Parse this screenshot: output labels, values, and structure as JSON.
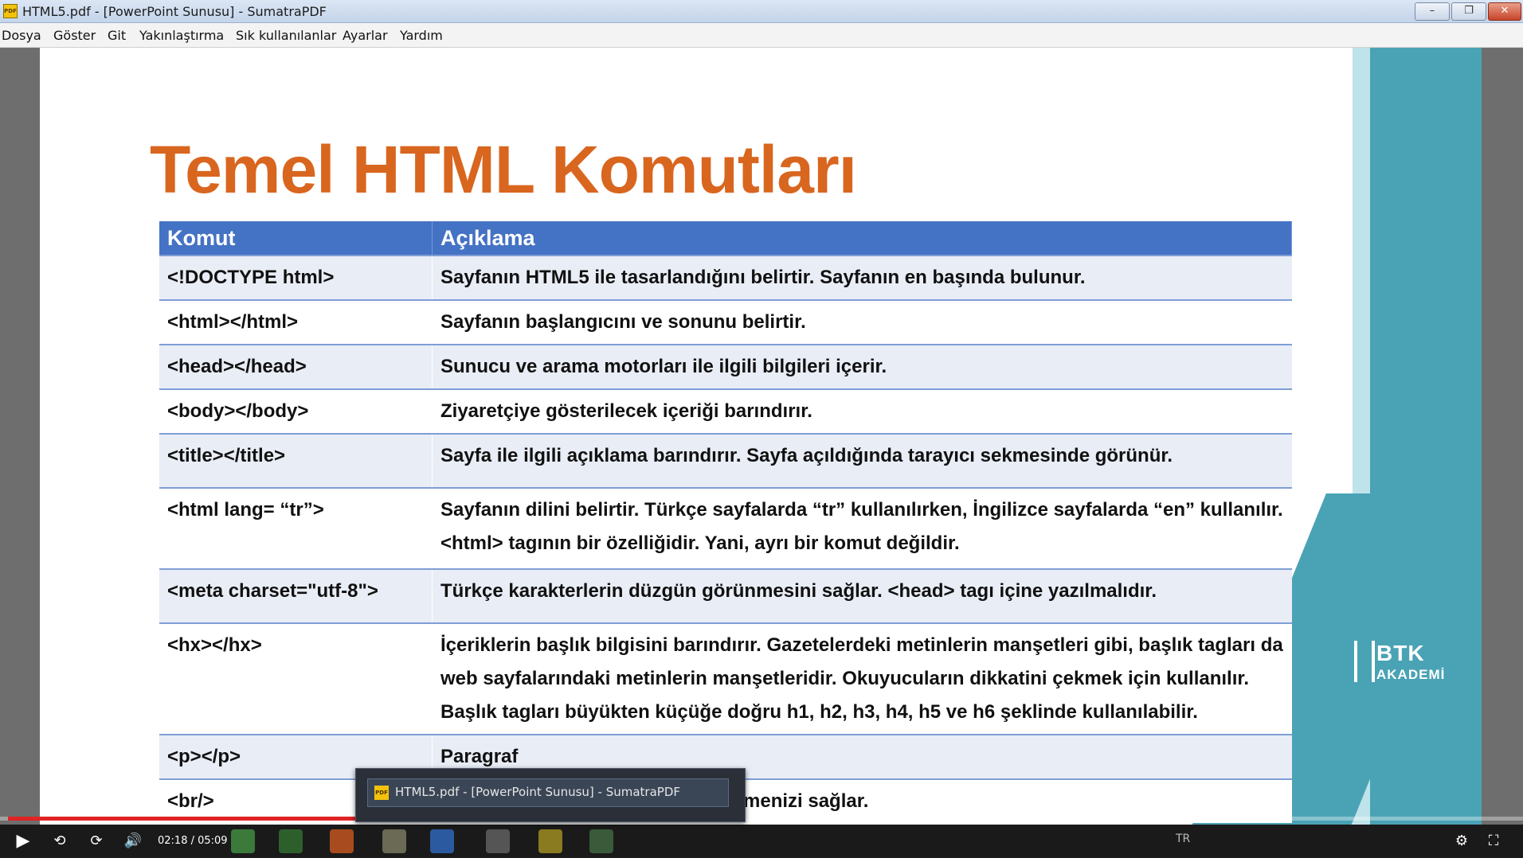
{
  "window": {
    "title": "HTML5.pdf - [PowerPoint Sunusu] - SumatraPDF",
    "icon": "sumatrapdf-icon",
    "controls": {
      "minimize": "–",
      "maximize": "❐",
      "close": "✕"
    }
  },
  "menu": [
    "Dosya",
    "Göster",
    "Git",
    "Yakınlaştırma",
    "Sık kullanılanlar",
    "Ayarlar",
    "Yardım"
  ],
  "slide": {
    "title": "Temel HTML Komutları",
    "logo": {
      "line1": "BTK",
      "line2": "AKADEMİ"
    },
    "table": {
      "headers": [
        "Komut",
        "Açıklama"
      ],
      "rows": [
        [
          "<!DOCTYPE html>",
          "Sayfanın HTML5 ile tasarlandığını belirtir. Sayfanın en başında bulunur."
        ],
        [
          "<html></html>",
          "Sayfanın başlangıcını ve sonunu belirtir."
        ],
        [
          "<head></head>",
          "Sunucu ve arama motorları ile ilgili bilgileri içerir."
        ],
        [
          "<body></body>",
          "Ziyaretçiye gösterilecek içeriği barındırır."
        ],
        [
          "<title></title>",
          "Sayfa ile ilgili açıklama barındırır. Sayfa açıldığında tarayıcı sekmesinde görünür."
        ],
        [
          "<html lang= “tr”>",
          "Sayfanın dilini belirtir. Türkçe sayfalarda “tr” kullanılırken, İngilizce sayfalarda “en” kullanılır. <html> tagının bir özelliğidir. Yani, ayrı bir komut değildir."
        ],
        [
          "<meta charset=\"utf-8\">",
          "Türkçe karakterlerin düzgün görünmesini sağlar. <head> tagı içine yazılmalıdır."
        ],
        [
          "<hx></hx>",
          "İçeriklerin başlık bilgisini barındırır. Gazetelerdeki metinlerin manşetleri gibi, başlık tagları da web sayfalarındaki metinlerin manşetleridir. Okuyucuların dikkatini çekmek için kullanılır. Başlık tagları büyükten küçüğe doğru h1, h2, h3, h4, h5 ve h6 şeklinde kullanılabilir."
        ],
        [
          "<p></p>",
          "Paragraf"
        ],
        [
          "<br/>",
          "menizi sağlar."
        ]
      ]
    }
  },
  "player": {
    "time": "02:18 / 05:09",
    "progress_fraction": 0.447,
    "controls": {
      "play": "▶",
      "back": "⟲",
      "forward": "⟳",
      "volume": "🔊",
      "settings": "⚙",
      "fullscreen": "⛶"
    },
    "tray": {
      "lang": "TR"
    }
  },
  "taskbar_popup": {
    "label": "HTML5.pdf - [PowerPoint Sunusu] - SumatraPDF"
  },
  "colors": {
    "title_orange": "#d9661f",
    "table_header": "#4472c4",
    "table_row_alt": "#e9edf6",
    "slide_teal": "#4aa3b5",
    "progress_red": "#e02424"
  }
}
